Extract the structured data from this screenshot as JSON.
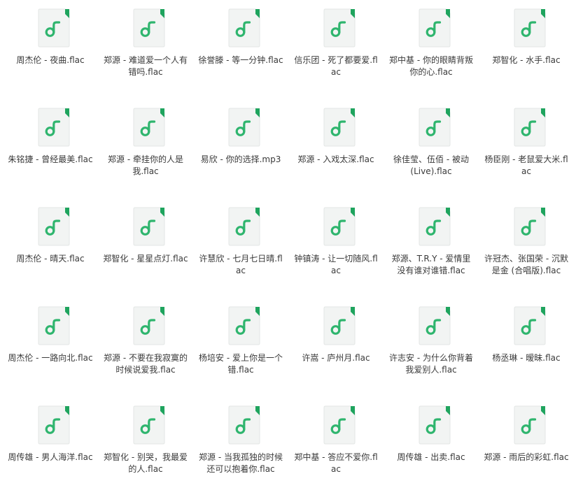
{
  "colors": {
    "accent": "#2fb56e",
    "page_fold": "#1fa45e",
    "file_paper": "#f2f4f3",
    "text": "#3a3a3a"
  },
  "icon": "music-file-icon",
  "files": [
    "周杰伦 - 夜曲.flac",
    "郑源 - 难道爱一个人有错吗.flac",
    "徐誉滕 - 等一分钟.flac",
    "信乐团 - 死了都要爱.flac",
    "郑中基 - 你的眼睛背叛你的心.flac",
    "郑智化 - 水手.flac",
    "朱铭捷 - 曾经最美.flac",
    "郑源 - 牵挂你的人是我.flac",
    "易欣 - 你的选择.mp3",
    "郑源 - 入戏太深.flac",
    "徐佳莹、伍佰 - 被动 (Live).flac",
    "杨臣刚 - 老鼠爱大米.flac",
    "周杰伦 - 晴天.flac",
    "郑智化 - 星星点灯.flac",
    "许慧欣 - 七月七日晴.flac",
    "钟镇涛 - 让一切随风.flac",
    "郑源、T.R.Y - 爱情里没有谁对谁错.flac",
    "许冠杰、张国荣 - 沉默是金 (合唱版).flac",
    "周杰伦 - 一路向北.flac",
    "郑源 - 不要在我寂寞的时候说爱我.flac",
    "杨培安 - 爱上你是一个错.flac",
    "许嵩 - 庐州月.flac",
    "许志安 - 为什么你背着我爱别人.flac",
    "杨丞琳 - 暧昧.flac",
    "周传雄 - 男人海洋.flac",
    "郑智化 - 别哭，我最爱的人.flac",
    "郑源 - 当我孤独的时候还可以抱着你.flac",
    "郑中基 - 答应不爱你.flac",
    "周传雄 - 出卖.flac",
    "郑源 - 雨后的彩虹.flac"
  ]
}
